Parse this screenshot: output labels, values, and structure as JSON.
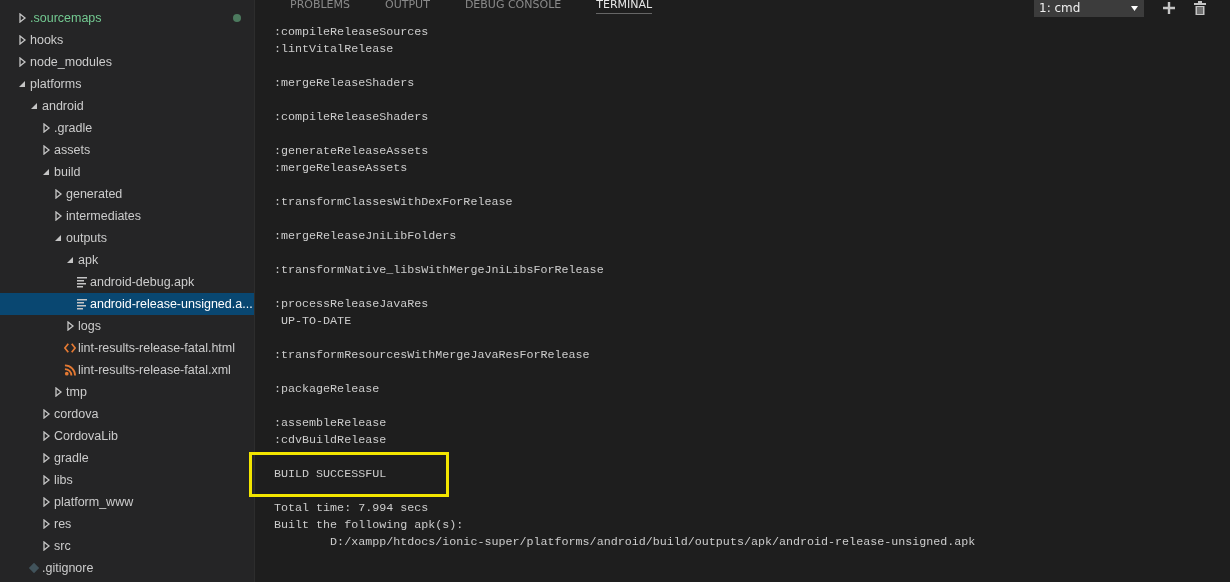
{
  "explorer": {
    "tree": [
      {
        "label": ".sourcemaps",
        "kind": "folder",
        "expanded": false,
        "selected": false,
        "modified": true
      },
      {
        "label": "hooks",
        "kind": "folder",
        "expanded": false,
        "selected": false,
        "modified": false
      },
      {
        "label": "node_modules",
        "kind": "folder",
        "expanded": false,
        "selected": false,
        "modified": false
      },
      {
        "label": "platforms",
        "kind": "folder",
        "expanded": true,
        "selected": false,
        "modified": false,
        "children": [
          {
            "label": "android",
            "kind": "folder",
            "expanded": true,
            "selected": false,
            "modified": false,
            "children": [
              {
                "label": ".gradle",
                "kind": "folder",
                "expanded": false,
                "selected": false,
                "modified": false
              },
              {
                "label": "assets",
                "kind": "folder",
                "expanded": false,
                "selected": false,
                "modified": false
              },
              {
                "label": "build",
                "kind": "folder",
                "expanded": true,
                "selected": false,
                "modified": false,
                "children": [
                  {
                    "label": "generated",
                    "kind": "folder",
                    "expanded": false,
                    "selected": false,
                    "modified": false
                  },
                  {
                    "label": "intermediates",
                    "kind": "folder",
                    "expanded": false,
                    "selected": false,
                    "modified": false
                  },
                  {
                    "label": "outputs",
                    "kind": "folder",
                    "expanded": true,
                    "selected": false,
                    "modified": false,
                    "children": [
                      {
                        "label": "apk",
                        "kind": "folder",
                        "expanded": true,
                        "selected": false,
                        "modified": false,
                        "children": [
                          {
                            "label": "android-debug.apk",
                            "kind": "file",
                            "selected": false,
                            "modified": false
                          },
                          {
                            "label": "android-release-unsigned.a...",
                            "kind": "file",
                            "selected": true,
                            "modified": false
                          }
                        ]
                      },
                      {
                        "label": "logs",
                        "kind": "folder",
                        "expanded": false,
                        "selected": false,
                        "modified": false
                      },
                      {
                        "label": "lint-results-release-fatal.html",
                        "kind": "html",
                        "selected": false,
                        "modified": false
                      },
                      {
                        "label": "lint-results-release-fatal.xml",
                        "kind": "xml",
                        "selected": false,
                        "modified": false
                      }
                    ]
                  },
                  {
                    "label": "tmp",
                    "kind": "folder",
                    "expanded": false,
                    "selected": false,
                    "modified": false
                  }
                ]
              },
              {
                "label": "cordova",
                "kind": "folder",
                "expanded": false,
                "selected": false,
                "modified": false
              },
              {
                "label": "CordovaLib",
                "kind": "folder",
                "expanded": false,
                "selected": false,
                "modified": false
              },
              {
                "label": "gradle",
                "kind": "folder",
                "expanded": false,
                "selected": false,
                "modified": false
              },
              {
                "label": "libs",
                "kind": "folder",
                "expanded": false,
                "selected": false,
                "modified": false
              },
              {
                "label": "platform_www",
                "kind": "folder",
                "expanded": false,
                "selected": false,
                "modified": false
              },
              {
                "label": "res",
                "kind": "folder",
                "expanded": false,
                "selected": false,
                "modified": false
              },
              {
                "label": "src",
                "kind": "folder",
                "expanded": false,
                "selected": false,
                "modified": false
              }
            ]
          },
          {
            "label": ".gitignore",
            "kind": "git",
            "selected": false,
            "modified": false
          }
        ]
      }
    ]
  },
  "panel": {
    "tabs": [
      {
        "label": "PROBLEMS",
        "selected": false
      },
      {
        "label": "OUTPUT",
        "selected": false
      },
      {
        "label": "DEBUG CONSOLE",
        "selected": false
      },
      {
        "label": "TERMINAL",
        "selected": true
      }
    ],
    "terminal_select": {
      "value": "1: cmd"
    },
    "terminal": {
      "blocks": [
        {
          "highlighted": false,
          "lines": [
            ":compileReleaseSources",
            ":lintVitalRelease"
          ]
        },
        {
          "highlighted": false,
          "lines": [
            ":mergeReleaseShaders"
          ]
        },
        {
          "highlighted": false,
          "lines": [
            ":compileReleaseShaders"
          ]
        },
        {
          "highlighted": false,
          "lines": [
            ":generateReleaseAssets",
            ":mergeReleaseAssets"
          ]
        },
        {
          "highlighted": false,
          "lines": [
            ":transformClassesWithDexForRelease"
          ]
        },
        {
          "highlighted": false,
          "lines": [
            ":mergeReleaseJniLibFolders"
          ]
        },
        {
          "highlighted": false,
          "lines": [
            ":transformNative_libsWithMergeJniLibsForRelease"
          ]
        },
        {
          "highlighted": false,
          "lines": [
            ":processReleaseJavaRes",
            " UP-TO-DATE"
          ]
        },
        {
          "highlighted": false,
          "lines": [
            ":transformResourcesWithMergeJavaResForRelease"
          ]
        },
        {
          "highlighted": false,
          "lines": [
            ":packageRelease"
          ]
        },
        {
          "highlighted": false,
          "lines": [
            ":assembleRelease",
            ":cdvBuildRelease"
          ]
        },
        {
          "highlighted": true,
          "lines": [
            "BUILD SUCCESSFUL"
          ]
        },
        {
          "highlighted": false,
          "lines": [
            "Total time: 7.994 secs",
            "Built the following apk(s):",
            "        D:/xampp/htdocs/ionic-super/platforms/android/build/outputs/apk/android-release-unsigned.apk"
          ]
        }
      ]
    }
  }
}
